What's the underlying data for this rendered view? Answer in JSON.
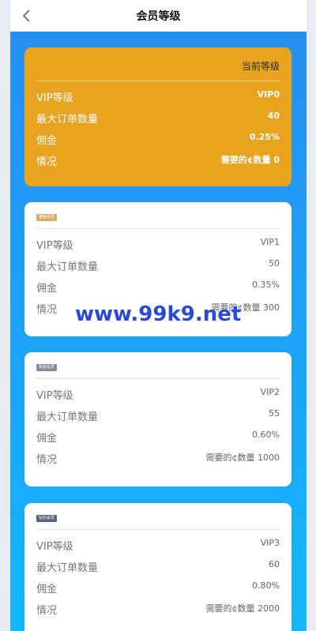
{
  "header": {
    "title": "会员等级",
    "back_icon": "chevron-left-icon"
  },
  "current_card": {
    "label": "当前等级",
    "rows": [
      {
        "label": "VIP等级",
        "value": "VIP0"
      },
      {
        "label": "最大订单数量",
        "value": "40"
      },
      {
        "label": "佣金",
        "value": "0.25%"
      },
      {
        "label": "情况",
        "value": "需要的¢数量 0"
      }
    ]
  },
  "cards": [
    {
      "badge": "黄金会员",
      "badge_color": "#d9a96a",
      "rows": [
        {
          "label": "VIP等级",
          "value": "VIP1"
        },
        {
          "label": "最大订单数量",
          "value": "50"
        },
        {
          "label": "佣金",
          "value": "0.35%"
        },
        {
          "label": "情况",
          "value": "需要的¢数量 300"
        }
      ]
    },
    {
      "badge": "铂金会员",
      "badge_color": "#8d84a0",
      "rows": [
        {
          "label": "VIP等级",
          "value": "VIP2"
        },
        {
          "label": "最大订单数量",
          "value": "55"
        },
        {
          "label": "佣金",
          "value": "0.60%"
        },
        {
          "label": "情况",
          "value": "需要的¢数量 1000"
        }
      ]
    },
    {
      "badge": "钻石会员",
      "badge_color": "#5a6378",
      "rows": [
        {
          "label": "VIP等级",
          "value": "VIP3"
        },
        {
          "label": "最大订单数量",
          "value": "60"
        },
        {
          "label": "佣金",
          "value": "0.80%"
        },
        {
          "label": "情况",
          "value": "需要的¢数量 2000"
        }
      ]
    }
  ],
  "watermark": "www.99k9.net"
}
